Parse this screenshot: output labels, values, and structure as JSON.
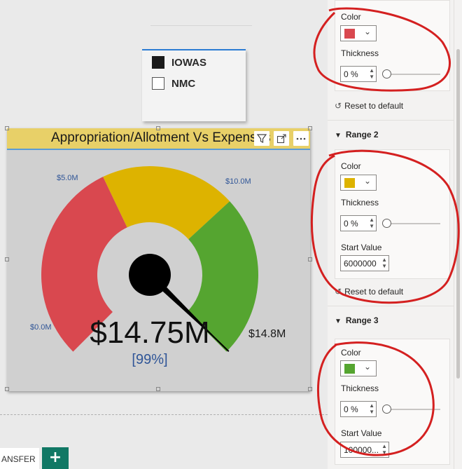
{
  "slicer": {
    "items": [
      {
        "label": "IOWAS",
        "checked": true
      },
      {
        "label": "NMC",
        "checked": false
      }
    ]
  },
  "visual": {
    "title": "Appropriation/Allotment Vs Expenses",
    "icons": [
      "filter-icon",
      "focus-mode-icon",
      "more-options-icon"
    ]
  },
  "chart_data": {
    "type": "gauge",
    "min_label": "$0.0M",
    "max_label": "$14.8M",
    "range_labels": [
      "$5.0M",
      "$10.0M"
    ],
    "ranges": [
      {
        "color": "#d9484f",
        "start": 0,
        "end": 6.0
      },
      {
        "color": "#ddb300",
        "start": 6.0,
        "end": 10.0
      },
      {
        "color": "#55a530",
        "start": 10.0,
        "end": 14.8
      }
    ],
    "min": 0,
    "max": 14.8,
    "value": 14.75,
    "value_label": "$14.75M",
    "percent_label": "[99%]"
  },
  "tabs": {
    "page_tab": "ANSFER",
    "add_label": "+"
  },
  "format_pane": {
    "range1": {
      "color_label": "Color",
      "color": "#d9484f",
      "thickness_label": "Thickness",
      "thickness": "0 %",
      "reset": "Reset to default"
    },
    "range2": {
      "header": "Range 2",
      "color_label": "Color",
      "color": "#ddb300",
      "thickness_label": "Thickness",
      "thickness": "0 %",
      "start_label": "Start Value",
      "start": "6000000",
      "reset": "Reset to default"
    },
    "range3": {
      "header": "Range 3",
      "color_label": "Color",
      "color": "#55a530",
      "thickness_label": "Thickness",
      "thickness": "0 %",
      "start_label": "Start Value",
      "start": "100000..."
    }
  },
  "annotation_color": "#d42020"
}
